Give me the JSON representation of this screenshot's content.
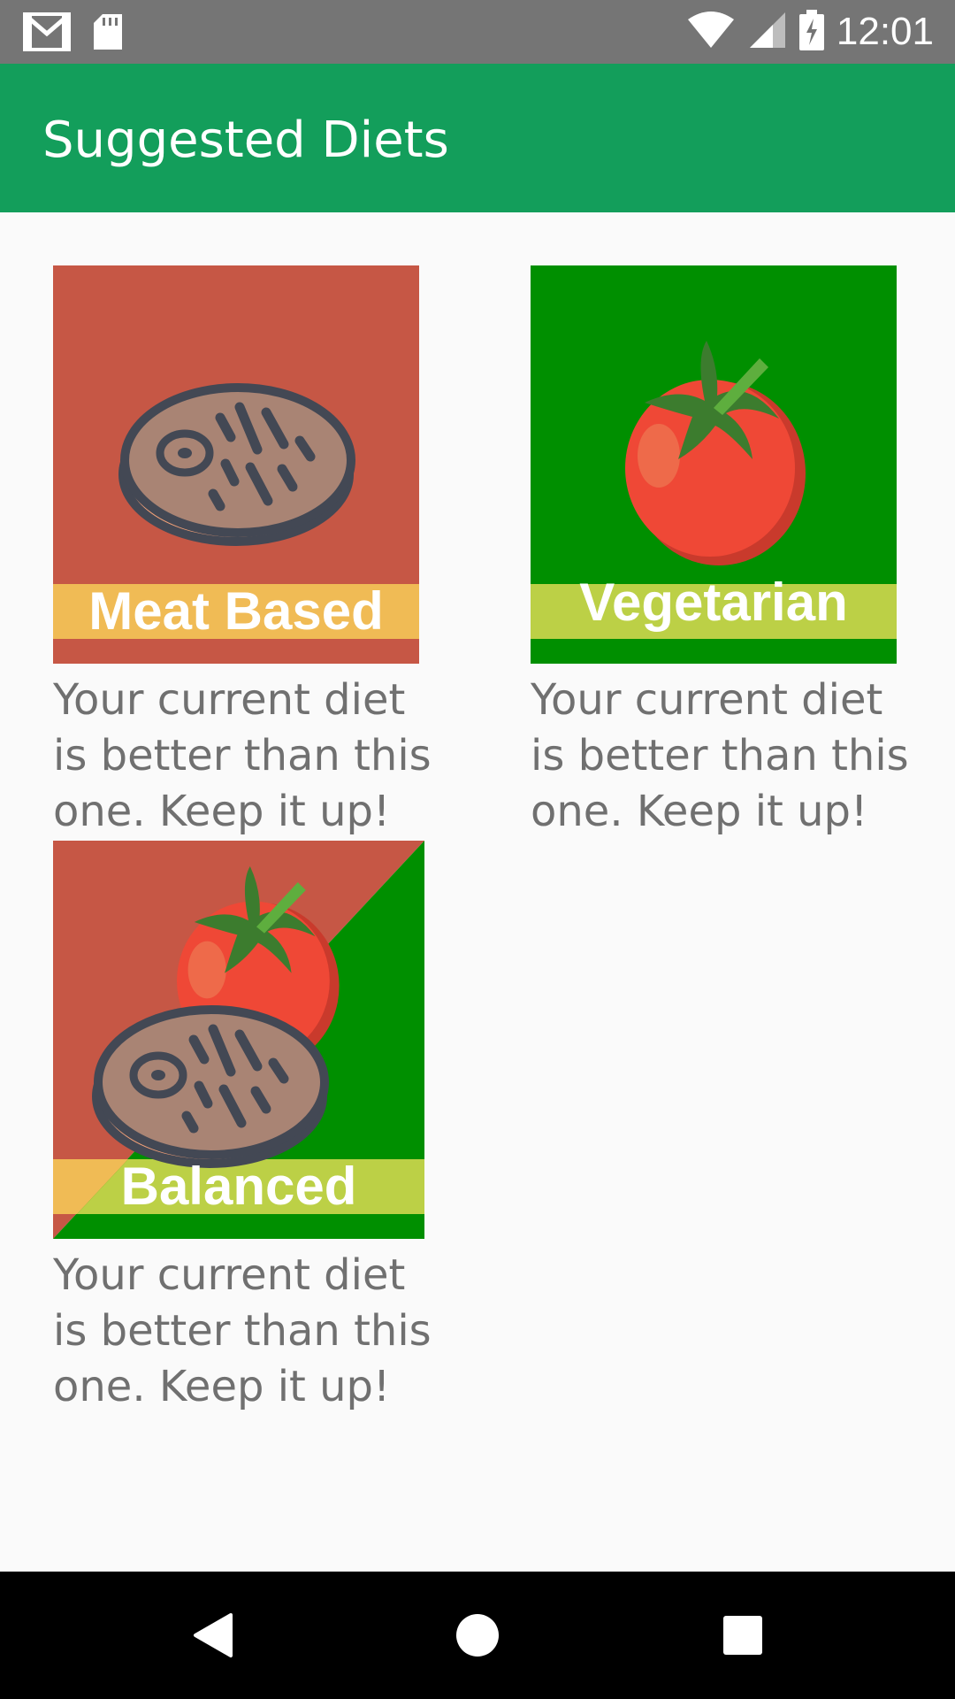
{
  "status_bar": {
    "time": "12:01",
    "icons": [
      "gmail-icon",
      "sd-card-icon",
      "wifi-icon",
      "signal-icon",
      "battery-charging-icon"
    ]
  },
  "app_bar": {
    "title": "Suggested Diets"
  },
  "diets": [
    {
      "label": "Meat Based",
      "description": "Your current diet is better than this one. Keep it up!",
      "colors": {
        "background": "#c65745",
        "band": "#f0bb55"
      }
    },
    {
      "label": "Vegetarian",
      "description": "Your current diet is better than this one. Keep it up!",
      "colors": {
        "background": "#008f00",
        "band": "#bcd046"
      }
    },
    {
      "label": "Balanced",
      "description": "Your current diet is better than this one. Keep it up!",
      "colors": {
        "background_left": "#c65745",
        "background_right": "#008f00",
        "band_left": "#f0bb55",
        "band_right": "#bcd046"
      }
    }
  ],
  "nav_bar": {
    "icons": [
      "back-icon",
      "home-icon",
      "recents-icon"
    ]
  }
}
